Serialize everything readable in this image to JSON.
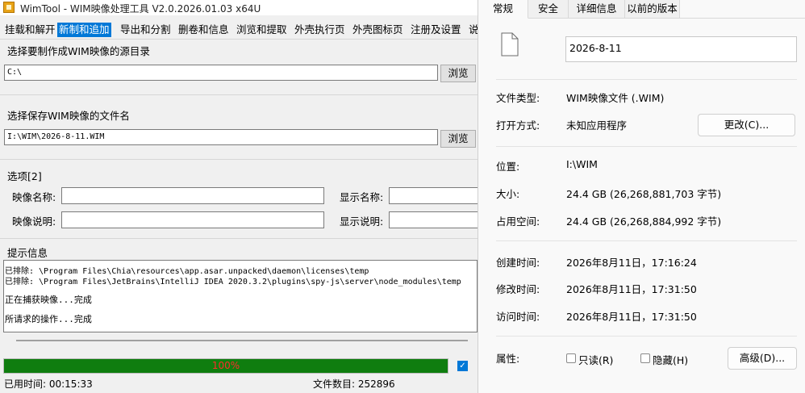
{
  "wimtool": {
    "title": "WimTool - WIM映像处理工具 V2.0.2026.01.03 x64U",
    "menu": [
      {
        "label": "挂载和解开",
        "active": false
      },
      {
        "label": "新制和追加",
        "active": true
      },
      {
        "label": "导出和分割",
        "active": false
      },
      {
        "label": "删卷和信息",
        "active": false
      },
      {
        "label": "浏览和提取",
        "active": false
      },
      {
        "label": "外壳执行页",
        "active": false
      },
      {
        "label": "外壳图标页",
        "active": false
      },
      {
        "label": "注册及设置",
        "active": false
      },
      {
        "label": "说",
        "active": false
      }
    ],
    "source_section": {
      "label": "选择要制作成WIM映像的源目录",
      "value": "C:\\",
      "browse_label": "浏览"
    },
    "target_section": {
      "label": "选择保存WIM映像的文件名",
      "value": "I:\\WIM\\2026-8-11.WIM",
      "browse_label": "浏览"
    },
    "options": {
      "label": "选项[2]",
      "image_name_label": "映像名称:",
      "image_name_value": "",
      "display_name_label": "显示名称:",
      "display_name_value": "",
      "image_desc_label": "映像说明:",
      "image_desc_value": "",
      "display_desc_label": "显示说明:",
      "display_desc_value": ""
    },
    "info": {
      "label": "提示信息",
      "lines": [
        "已排除: \\Program Files\\Chia\\resources\\app.asar.unpacked\\daemon\\licenses\\temp",
        "已排除: \\Program Files\\JetBrains\\IntelliJ IDEA 2020.3.2\\plugins\\spy-js\\server\\node_modules\\temp",
        "正在捕获映像...完成",
        "所请求的操作...完成"
      ]
    },
    "progress": {
      "percent": 100,
      "text": "100%"
    },
    "checkbox": {
      "checked": true
    },
    "status": {
      "elapsed": "已用时间:  00:15:33",
      "file_count": "文件数目:  252896"
    }
  },
  "properties": {
    "tabs": [
      {
        "label": "常规",
        "active": true
      },
      {
        "label": "安全",
        "active": false
      },
      {
        "label": "详细信息",
        "active": false
      },
      {
        "label": "以前的版本",
        "active": false
      }
    ],
    "file_name": "2026-8-11",
    "file_type_label": "文件类型:",
    "file_type_value": "WIM映像文件 (.WIM)",
    "opens_with_label": "打开方式:",
    "opens_with_value": "未知应用程序",
    "change_button": "更改(C)...",
    "location_label": "位置:",
    "location_value": "I:\\WIM",
    "size_label": "大小:",
    "size_value": "24.4 GB (26,268,881,703 字节)",
    "size_on_disk_label": "占用空间:",
    "size_on_disk_value": "24.4 GB (26,268,884,992 字节)",
    "created_label": "创建时间:",
    "created_value": "2026年8月11日，17:16:24",
    "modified_label": "修改时间:",
    "modified_value": "2026年8月11日，17:31:50",
    "accessed_label": "访问时间:",
    "accessed_value": "2026年8月11日，17:31:50",
    "attributes_label": "属性:",
    "readonly_label": "只读(R)",
    "hidden_label": "隐藏(H)",
    "advanced_button": "高级(D)..."
  }
}
